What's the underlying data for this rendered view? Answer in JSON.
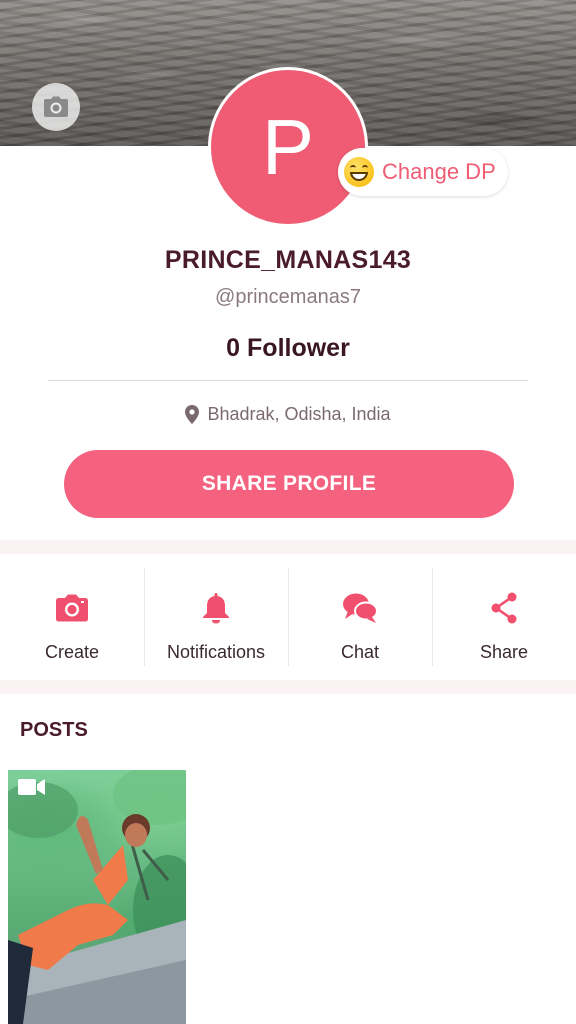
{
  "profile": {
    "avatar_letter": "P",
    "change_dp_label": "Change DP",
    "name": "PRINCE_MANAS143",
    "handle": "@princemanas7",
    "followers": "0 Follower",
    "location": "Bhadrak, Odisha, India",
    "share_button": "SHARE PROFILE"
  },
  "actions": [
    {
      "label": "Create",
      "icon": "camera-icon"
    },
    {
      "label": "Notifications",
      "icon": "bell-icon"
    },
    {
      "label": "Chat",
      "icon": "chat-icon"
    },
    {
      "label": "Share",
      "icon": "share-icon"
    }
  ],
  "posts": {
    "title": "POSTS",
    "items": [
      {
        "type": "video",
        "icon": "video-icon"
      }
    ]
  },
  "colors": {
    "accent": "#f5627f",
    "avatar_bg": "#ef5c73",
    "heading_text": "#4a1b2b"
  }
}
